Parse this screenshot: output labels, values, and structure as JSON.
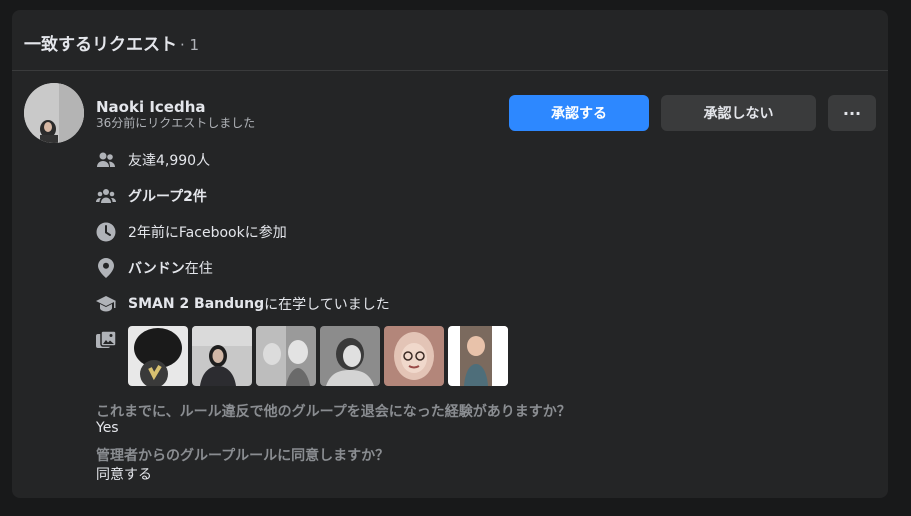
{
  "header": {
    "title": "一致するリクエスト",
    "count": "· 1"
  },
  "request": {
    "name": "Naoki Icedha",
    "time": "36分前にリクエストしました",
    "approve_label": "承認する",
    "decline_label": "承認しない",
    "more_label": "···"
  },
  "info": {
    "friends": "友達4,990人",
    "groups": "グループ2件",
    "joined": "2年前にFacebookに参加",
    "city_bold": "バンドン",
    "city_suffix": "在住",
    "school_bold": "SMAN 2 Bandung",
    "school_suffix": "に在学していました"
  },
  "questions": [
    {
      "q": "これまでに、ルール違反で他のグループを退会になった経験がありますか？",
      "a": "Yes"
    },
    {
      "q": "管理者からのグループルールに同意しますか？",
      "a": "同意する"
    }
  ],
  "colors": {
    "primary": "#2d88ff",
    "card": "#242526",
    "background": "#18191a"
  },
  "icons": [
    "friends-icon",
    "groups-icon",
    "clock-icon",
    "location-pin-icon",
    "graduation-cap-icon",
    "photos-icon",
    "more-dots-icon"
  ]
}
